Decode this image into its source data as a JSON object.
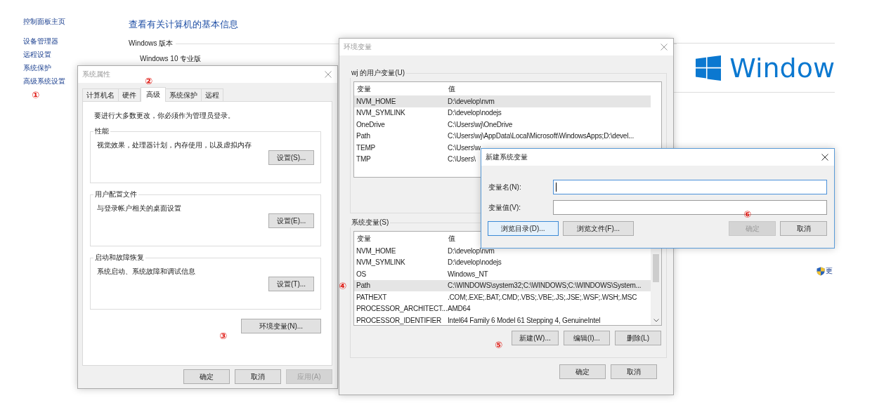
{
  "control_panel": {
    "sidebar": [
      {
        "label": "控制面板主页"
      },
      {
        "label": "设备管理器"
      },
      {
        "label": "远程设置"
      },
      {
        "label": "系统保护"
      },
      {
        "label": "高级系统设置"
      }
    ],
    "title": "查看有关计算机的基本信息",
    "section_label": "Windows 版本",
    "edition": "Windows 10 专业版",
    "logo_text": "Window",
    "link_text": "更"
  },
  "system_properties": {
    "title": "系统属性",
    "tabs": [
      {
        "label": "计算机名",
        "selected": false
      },
      {
        "label": "硬件",
        "selected": false
      },
      {
        "label": "高级",
        "selected": true
      },
      {
        "label": "系统保护",
        "selected": false
      },
      {
        "label": "远程",
        "selected": false
      }
    ],
    "notice": "要进行大多数更改，你必须作为管理员登录。",
    "groups": [
      {
        "title": "性能",
        "description": "视觉效果，处理器计划，内存使用，以及虚拟内存",
        "button": "设置(S)..."
      },
      {
        "title": "用户配置文件",
        "description": "与登录帐户相关的桌面设置",
        "button": "设置(E)..."
      },
      {
        "title": "启动和故障恢复",
        "description": "系统启动、系统故障和调试信息",
        "button": "设置(T)..."
      }
    ],
    "env_button": "环境变量(N)...",
    "buttons": [
      {
        "label": "确定",
        "disabled": false
      },
      {
        "label": "取消",
        "disabled": false
      },
      {
        "label": "应用(A)",
        "disabled": true
      }
    ]
  },
  "environment_variables": {
    "title": "环境变量",
    "user_group": {
      "title": "wj 的用户变量(U)",
      "columns": [
        "变量",
        "值"
      ],
      "rows": [
        {
          "name": "NVM_HOME",
          "value": "D:\\develop\\nvm",
          "selected": true
        },
        {
          "name": "NVM_SYMLINK",
          "value": "D:\\develop\\nodejs",
          "selected": false
        },
        {
          "name": "OneDrive",
          "value": "C:\\Users\\wj\\OneDrive",
          "selected": false
        },
        {
          "name": "Path",
          "value": "C:\\Users\\wj\\AppData\\Local\\Microsoft\\WindowsApps;D:\\devel...",
          "selected": false
        },
        {
          "name": "TEMP",
          "value": "C:\\Users\\w",
          "selected": false
        },
        {
          "name": "TMP",
          "value": "C:\\Users\\",
          "selected": false
        }
      ]
    },
    "system_group": {
      "title": "系统变量(S)",
      "columns": [
        "变量",
        "值"
      ],
      "rows": [
        {
          "name": "NVM_HOME",
          "value": "D:\\develop\\nvm",
          "selected": false
        },
        {
          "name": "NVM_SYMLINK",
          "value": "D:\\develop\\nodejs",
          "selected": false
        },
        {
          "name": "OS",
          "value": "Windows_NT",
          "selected": false
        },
        {
          "name": "Path",
          "value": "C:\\WINDOWS\\system32;C:\\WINDOWS;C:\\WINDOWS\\System...",
          "selected": true
        },
        {
          "name": "PATHEXT",
          "value": ".COM;.EXE;.BAT;.CMD;.VBS;.VBE;.JS;.JSE;.WSF;.WSH;.MSC",
          "selected": false
        },
        {
          "name": "PROCESSOR_ARCHITECT...",
          "value": "AMD64",
          "selected": false
        },
        {
          "name": "PROCESSOR_IDENTIFIER",
          "value": "Intel64 Family 6 Model 61 Stepping 4, GenuineIntel",
          "selected": false
        }
      ],
      "buttons": [
        "新建(W)...",
        "编辑(I)...",
        "删除(L)"
      ]
    },
    "buttons": [
      "确定",
      "取消"
    ]
  },
  "new_variable_dialog": {
    "title": "新建系统变量",
    "fields": [
      {
        "label": "变量名(N):",
        "focused": true
      },
      {
        "label": "变量值(V):",
        "focused": false
      }
    ],
    "buttons": [
      {
        "label": "浏览目录(D)...",
        "disabled": false,
        "focused": true
      },
      {
        "label": "浏览文件(F)...",
        "disabled": false,
        "focused": false
      },
      {
        "label": "确定",
        "disabled": true,
        "focused": false
      },
      {
        "label": "取消",
        "disabled": false,
        "focused": false
      }
    ]
  },
  "annotations": [
    {
      "text": "①"
    },
    {
      "text": "②"
    },
    {
      "text": "③"
    },
    {
      "text": "④"
    },
    {
      "text": "⑤"
    },
    {
      "text": "⑥"
    }
  ]
}
